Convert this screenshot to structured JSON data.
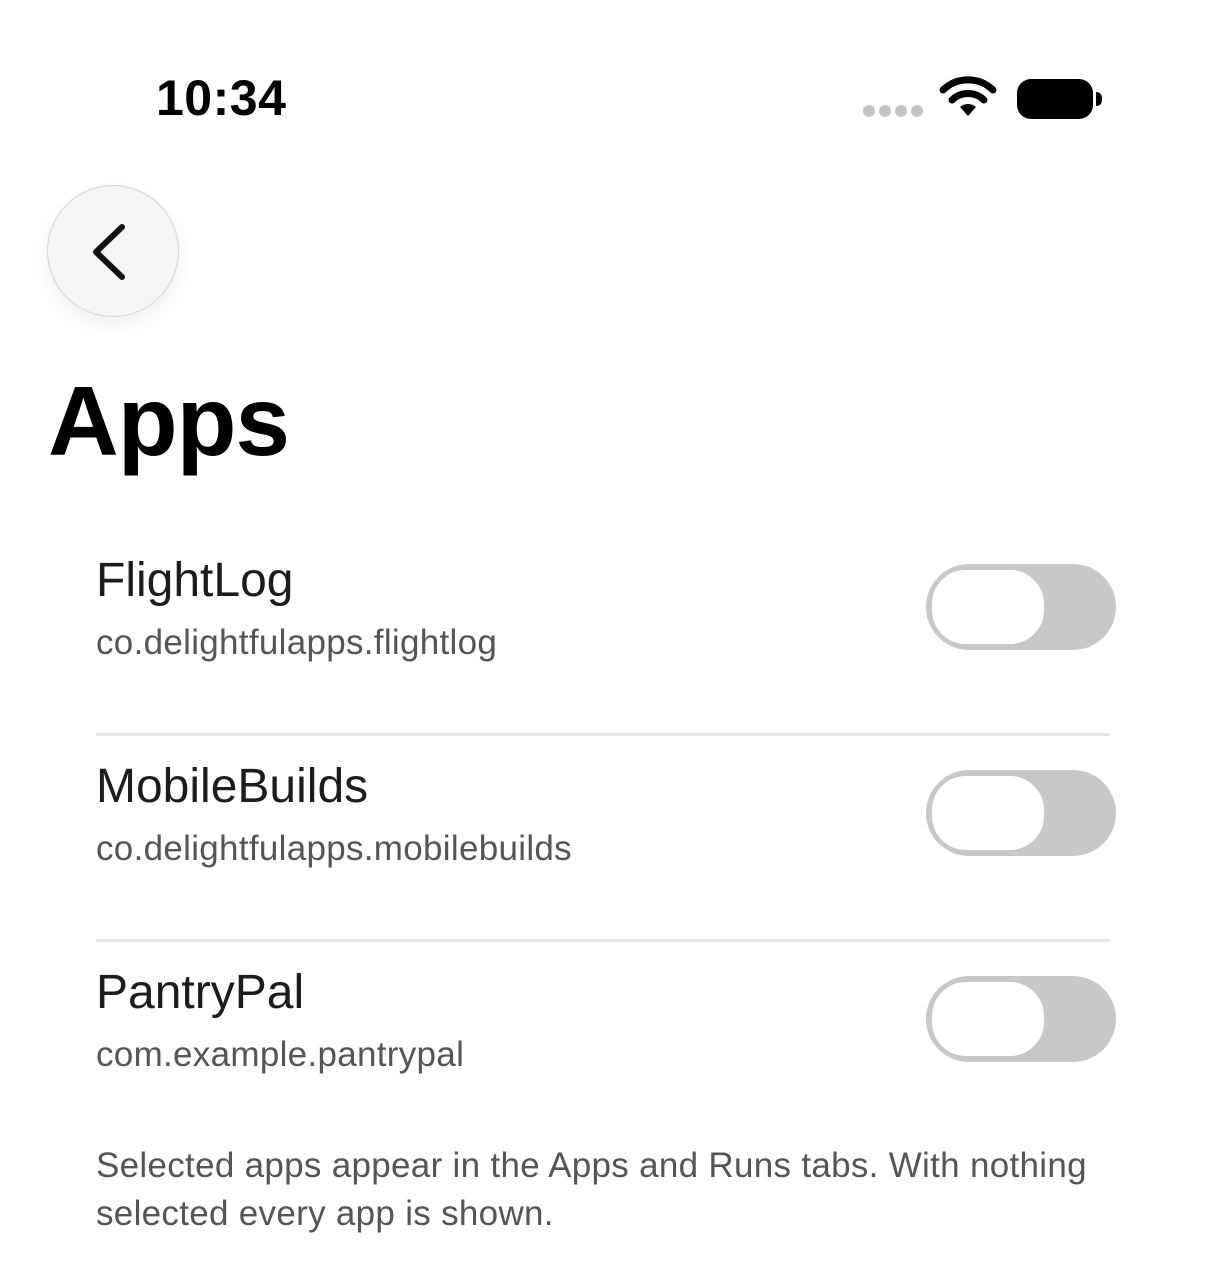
{
  "status_bar": {
    "time": "10:34",
    "icons": [
      "cellular-dots-icon",
      "wifi-icon",
      "battery-icon"
    ]
  },
  "nav": {
    "back_icon": "chevron-left-icon"
  },
  "page": {
    "title": "Apps"
  },
  "apps": [
    {
      "name": "FlightLog",
      "bundle_id": "co.delightfulapps.flightlog",
      "enabled": false
    },
    {
      "name": "MobileBuilds",
      "bundle_id": "co.delightfulapps.mobilebuilds",
      "enabled": false
    },
    {
      "name": "PantryPal",
      "bundle_id": "com.example.pantrypal",
      "enabled": false
    }
  ],
  "footnote": "Selected apps appear in the Apps and Runs tabs. With nothing selected every app is shown.",
  "colors": {
    "toggle_off": "#c8c8c8",
    "secondary_text": "#555555",
    "divider": "#e8e8e8"
  }
}
